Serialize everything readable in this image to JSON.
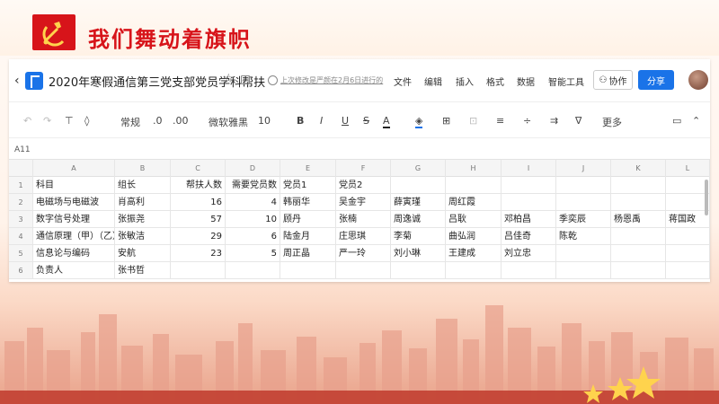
{
  "slide": {
    "title": "我们舞动着旗帜",
    "accent_color": "#d7141a"
  },
  "app": {
    "doc_title": "2020年寒假通信第三党支部党员学科帮扶",
    "last_edit": "上次修改是严颜在2月6日进行的",
    "menus": [
      "文件",
      "编辑",
      "插入",
      "格式",
      "数据",
      "智能工具"
    ],
    "collab_label": "协作",
    "share_label": "分享"
  },
  "toolbar": {
    "format_label": "常规",
    "decimal_dec": ".0",
    "decimal_inc": ".00",
    "font_name": "微软雅黑",
    "font_size": "10",
    "more_label": "更多"
  },
  "formula": {
    "cell_ref": "A11"
  },
  "sheet": {
    "columns": [
      "A",
      "B",
      "C",
      "D",
      "E",
      "F",
      "G",
      "H",
      "I",
      "J",
      "K",
      "L"
    ],
    "rows": [
      [
        "科目",
        "组长",
        "帮扶人数",
        "需要党员数",
        "党员1",
        "党员2",
        "",
        "",
        "",
        "",
        "",
        ""
      ],
      [
        "电磁场与电磁波",
        "肖高利",
        "16",
        "4",
        "韩丽华",
        "吴金宇",
        "薛寅瑾",
        "周红霞",
        "",
        "",
        "",
        ""
      ],
      [
        "数字信号处理",
        "张振尧",
        "57",
        "10",
        "顾丹",
        "张楠",
        "周逸诚",
        "吕耿",
        "邓柏昌",
        "季奕辰",
        "杨恩禹",
        "蒋国政"
      ],
      [
        "通信原理（甲）（乙）",
        "张敏洁",
        "29",
        "6",
        "陆金月",
        "庄思琪",
        "李菊",
        "曲弘润",
        "吕佳奇",
        "陈乾",
        "",
        ""
      ],
      [
        "信息论与编码",
        "安航",
        "23",
        "5",
        "周正晶",
        "严一玲",
        "刘小琳",
        "王建成",
        "刘立忠",
        "",
        "",
        ""
      ],
      [
        "负责人",
        "张书哲",
        "",
        "",
        "",
        "",
        "",
        "",
        "",
        "",
        "",
        ""
      ]
    ],
    "numeric_cols": [
      2,
      3
    ]
  }
}
